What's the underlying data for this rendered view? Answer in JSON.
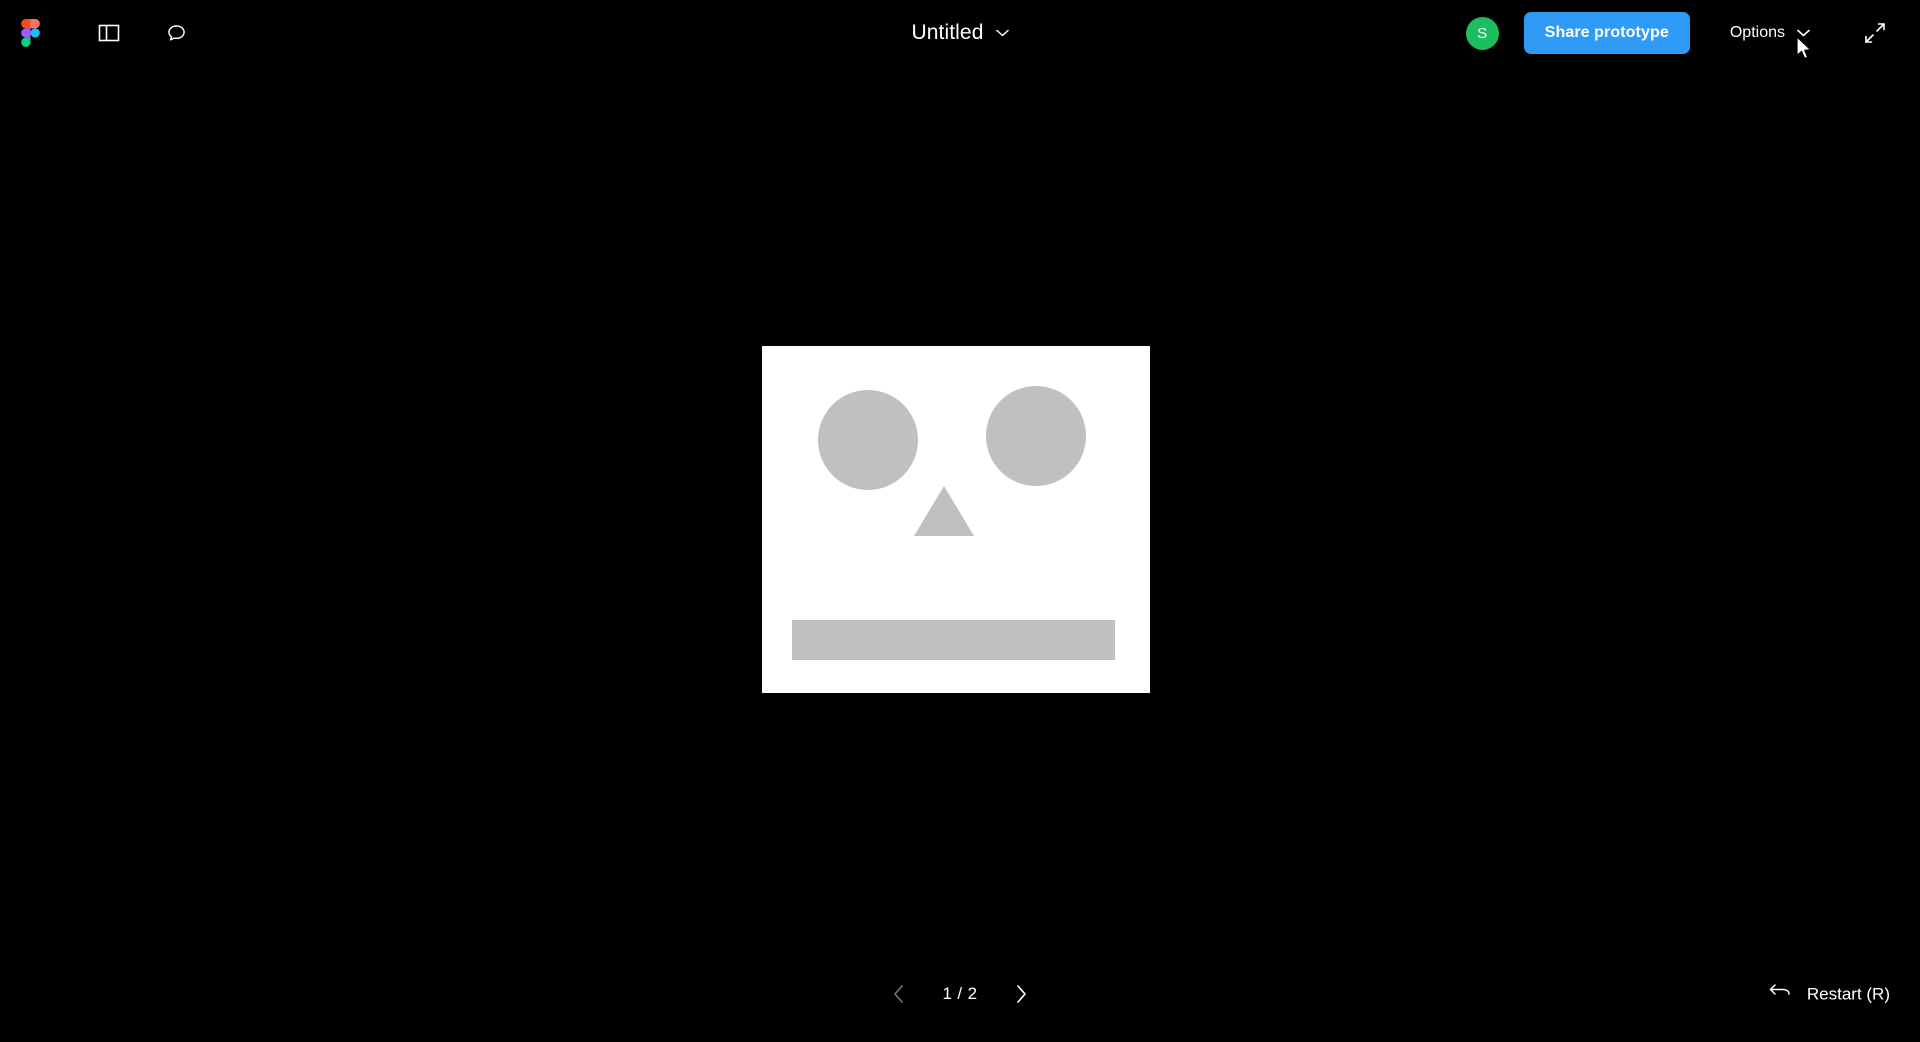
{
  "app": {
    "name": "Figma",
    "mode": "prototype-presentation",
    "background_color": "#000000"
  },
  "topbar": {
    "logo": {
      "icon": "figma-logo-icon"
    },
    "sidebar_toggle": {
      "icon": "sidebar-panel-icon"
    },
    "comments": {
      "icon": "comment-bubble-icon"
    },
    "title": "Untitled",
    "title_chevron_icon": "chevron-down-icon",
    "avatar": {
      "initial": "S",
      "color": "#1bbf5e"
    },
    "share_button": {
      "label": "Share prototype",
      "color": "#2f9bf6"
    },
    "options": {
      "label": "Options",
      "icon": "chevron-down-icon"
    },
    "fullscreen": {
      "icon": "fullscreen-expand-icon"
    }
  },
  "canvas": {
    "artboard": {
      "background_color": "#ffffff",
      "shape_color": "#c0c0c0",
      "shapes": [
        {
          "name": "eye-left",
          "type": "circle"
        },
        {
          "name": "eye-right",
          "type": "circle"
        },
        {
          "name": "nose",
          "type": "triangle"
        },
        {
          "name": "mouth",
          "type": "rectangle"
        }
      ]
    }
  },
  "bottombar": {
    "prev_icon": "chevron-left-icon",
    "next_icon": "chevron-right-icon",
    "page_indicator": "1 / 2",
    "current_page": 1,
    "total_pages": 2,
    "restart": {
      "label": "Restart (R)",
      "icon": "restart-arrow-icon"
    }
  },
  "cursor": {
    "type": "arrow-pointer"
  }
}
